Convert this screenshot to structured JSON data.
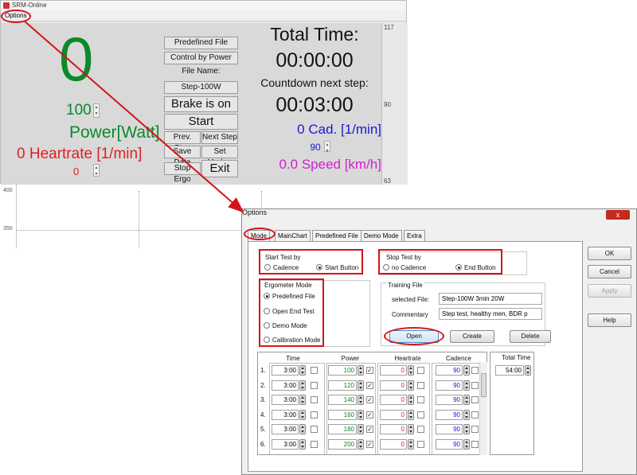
{
  "app": {
    "title": "SRM-Online",
    "menu_options": "Options"
  },
  "main": {
    "power_display": "0",
    "power_setpoint": "100",
    "power_label": "Power[Watt]",
    "heartrate_label": "0 Heartrate [1/min]",
    "heartrate_setpoint": "0",
    "buttons": {
      "predefined_file": "Predefined File",
      "control_by_power": "Control by Power",
      "file_name_label": "File Name:",
      "file_name": "Step-100W",
      "brake": "Brake is on",
      "start": "Start",
      "prev_step": "Prev. Step",
      "next_step": "Next Step",
      "save_data": "Save Data",
      "set_marker": "Set Marker",
      "stop_ergo": "Stop Ergo",
      "exit": "Exit"
    },
    "total_time_label": "Total Time:",
    "total_time": "00:00:00",
    "countdown_label": "Countdown next step:",
    "countdown": "00:03:00",
    "cadence_label": "0 Cad. [1/min]",
    "cadence_setpoint": "90",
    "speed_label": "0.0 Speed [km/h]",
    "axis_ticks": [
      "117",
      "90",
      "63"
    ]
  },
  "chart_bg": {
    "ticks": [
      "400",
      "350"
    ]
  },
  "dialog": {
    "title": "Options",
    "close": "x",
    "tabs": [
      "Mode",
      "MainChart",
      "Predefined File",
      "Demo Mode",
      "Extra"
    ],
    "start_test": {
      "title": "Start Test by",
      "options": [
        "Cadence",
        "Start Button"
      ],
      "selected": "Start Button"
    },
    "stop_test": {
      "title": "Stop Test by",
      "options": [
        "no Cadence",
        "End Button"
      ],
      "selected": "End Button"
    },
    "ergometer_mode": {
      "title": "Ergometer Mode",
      "options": [
        "Predefined File",
        "Open End Test",
        "Demo Mode",
        "Calibration Mode"
      ],
      "selected": "Predefined File"
    },
    "training_file": {
      "title": "Training File",
      "selected_file_label": "selected File:",
      "selected_file": "Step-100W 3min 20W",
      "commentary_label": "Commentary",
      "commentary": "Step test, healthy men, BDR p",
      "open": "Open",
      "create": "Create",
      "delete": "Delete"
    },
    "grid": {
      "headers": [
        "Time",
        "Power",
        "Heartrate",
        "Cadence"
      ],
      "rows": [
        {
          "n": "1.",
          "time": "3:00",
          "power": "100",
          "hr": "0",
          "cad": "90"
        },
        {
          "n": "2.",
          "time": "3:00",
          "power": "120",
          "hr": "0",
          "cad": "90"
        },
        {
          "n": "3.",
          "time": "3:00",
          "power": "140",
          "hr": "0",
          "cad": "90"
        },
        {
          "n": "4.",
          "time": "3:00",
          "power": "160",
          "hr": "0",
          "cad": "90"
        },
        {
          "n": "5.",
          "time": "3:00",
          "power": "180",
          "hr": "0",
          "cad": "90"
        },
        {
          "n": "6.",
          "time": "3:00",
          "power": "200",
          "hr": "0",
          "cad": "90"
        }
      ]
    },
    "total_time": {
      "label": "Total Time",
      "value": "54:00"
    },
    "side_buttons": {
      "ok": "OK",
      "cancel": "Cancel",
      "apply": "Apply",
      "help": "Help"
    }
  },
  "colors": {
    "power": "#0a8a2a",
    "heartrate": "#e02020",
    "cadence": "#1a1ad0",
    "speed": "#d020d0",
    "highlight": "#d3141b"
  }
}
